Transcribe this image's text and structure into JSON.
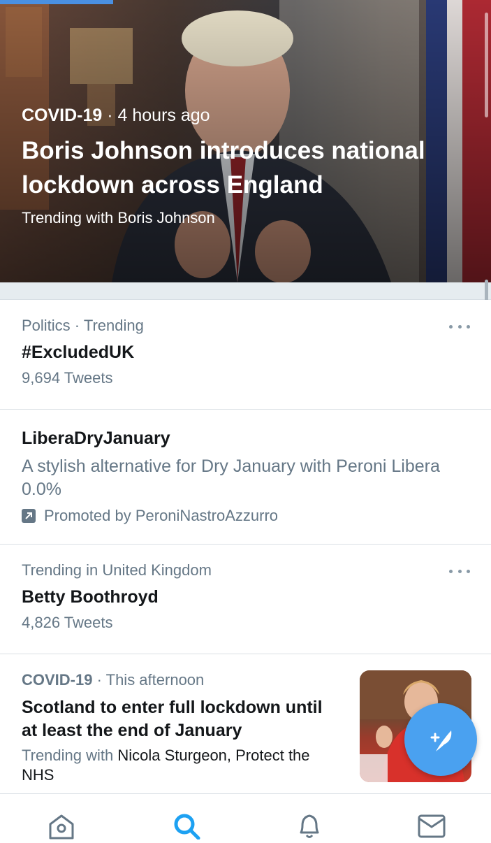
{
  "hero": {
    "topic": "COVID-19",
    "time": " · 4 hours ago",
    "title": "Boris Johnson introduces national lockdown across England",
    "subtitle": "Trending with Boris Johnson"
  },
  "trends": [
    {
      "meta": "Politics · Trending",
      "name": "#ExcludedUK",
      "count": "9,694 Tweets"
    },
    {
      "name": "LiberaDryJanuary",
      "description": "A stylish alternative for Dry January with Peroni Libera 0.0%",
      "promoted": "Promoted by PeroniNastroAzzurro"
    },
    {
      "meta": "Trending in United Kingdom",
      "name": "Betty Boothroyd",
      "count": "4,826 Tweets"
    }
  ],
  "news": {
    "topic": "COVID-19",
    "time": " · This afternoon",
    "title": "Scotland to enter full lockdown until at least the end of January",
    "trending_prefix": "Trending with ",
    "trending_names": "Nicola Sturgeon, Protect the NHS"
  },
  "tabs": [
    "home-icon",
    "search-icon",
    "bell-icon",
    "mail-icon"
  ],
  "colors": {
    "accent": "#1da1f2",
    "fab": "#4aa1f0",
    "muted": "#657786"
  }
}
